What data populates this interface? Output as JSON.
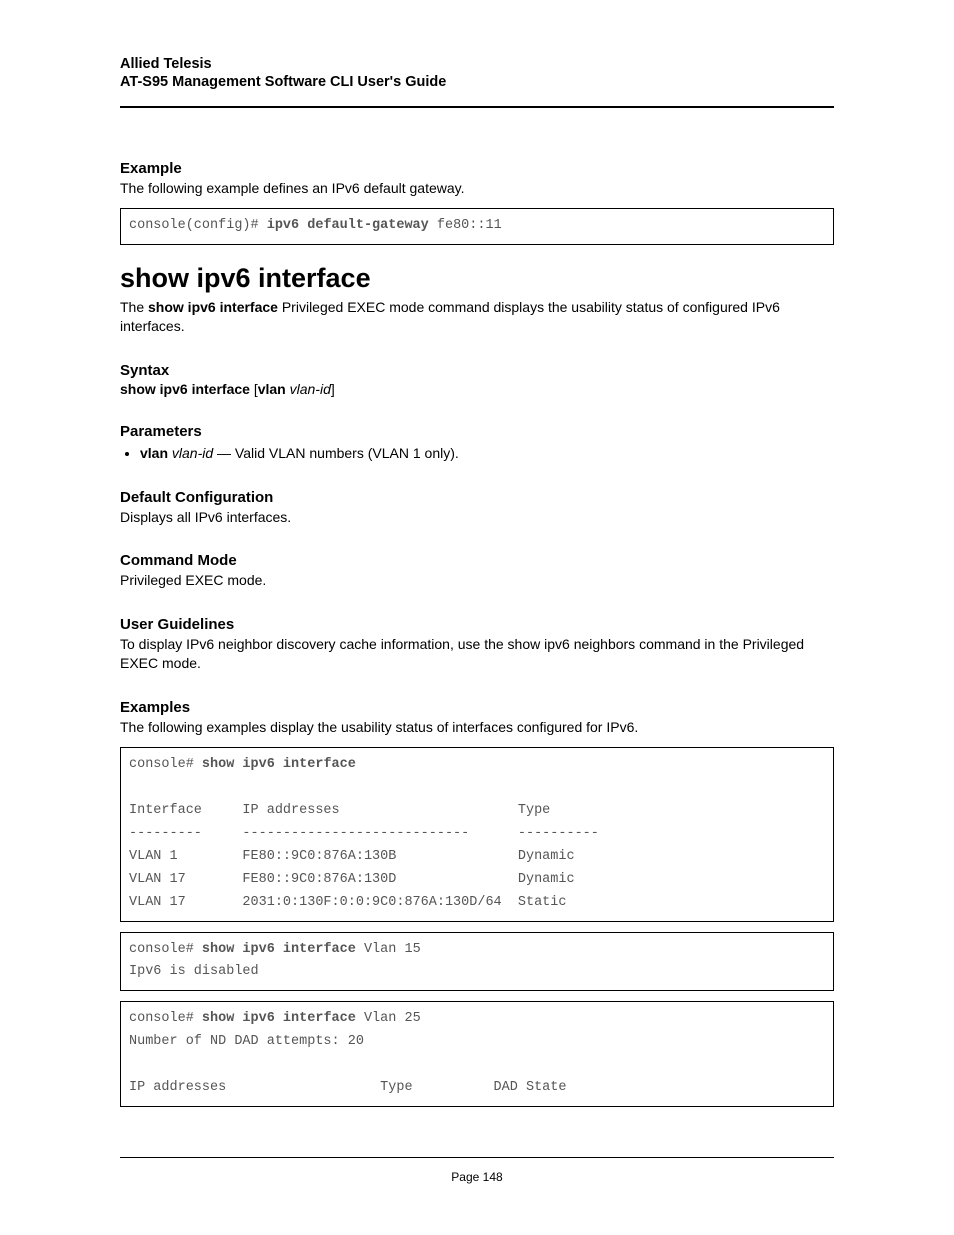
{
  "header": {
    "company": "Allied Telesis",
    "guide": "AT-S95 Management Software CLI User's Guide"
  },
  "example_section": {
    "heading": "Example",
    "text": "The following example defines an IPv6 default gateway.",
    "code_prefix": "console(config)# ",
    "code_cmd": "ipv6 default-gateway",
    "code_suffix": " fe80::11"
  },
  "command": {
    "title": "show ipv6 interface",
    "desc_pre": "The ",
    "desc_bold": "show ipv6 interface",
    "desc_post": " Privileged EXEC mode command displays the usability status of configured IPv6 interfaces."
  },
  "syntax": {
    "heading": "Syntax",
    "b1": "show ipv6 interface",
    "bracket_open": " [",
    "b2": "vlan",
    "space": " ",
    "i1": "vlan-id",
    "bracket_close": "]"
  },
  "parameters": {
    "heading": "Parameters",
    "item_b": "vlan",
    "item_i": "vlan-id",
    "item_rest": " — Valid VLAN numbers (VLAN 1 only)."
  },
  "default_config": {
    "heading": "Default Configuration",
    "text": "Displays all IPv6 interfaces."
  },
  "command_mode": {
    "heading": "Command Mode",
    "text": "Privileged EXEC mode."
  },
  "user_guidelines": {
    "heading": "User Guidelines",
    "pre": "To display IPv6 neighbor discovery cache information, use the ",
    "bold": "show ipv6 neighbors",
    "post": " command in the Privileged EXEC mode."
  },
  "examples": {
    "heading": "Examples",
    "text": "The following examples display the usability status of interfaces configured for IPv6.",
    "box1_prefix": "console# ",
    "box1_cmd": "show ipv6 interface",
    "box1_blank": "",
    "box1_header": "Interface     IP addresses                      Type",
    "box1_divider": "---------     ----------------------------      ----------",
    "box1_r1": "VLAN 1        FE80::9C0:876A:130B               Dynamic",
    "box1_r2": "VLAN 17       FE80::9C0:876A:130D               Dynamic",
    "box1_r3": "VLAN 17       2031:0:130F:0:0:9C0:876A:130D/64  Static",
    "box2_prefix": "console# ",
    "box2_cmd": "show ipv6 interface",
    "box2_suffix": " Vlan 15",
    "box2_l2": "Ipv6 is disabled",
    "box3_prefix": "console# ",
    "box3_cmd": "show ipv6 interface",
    "box3_suffix": " Vlan 25",
    "box3_l2": "Number of ND DAD attempts: 20",
    "box3_blank": "",
    "box3_header": "IP addresses                   Type          DAD State"
  },
  "footer": {
    "page": "Page 148"
  }
}
